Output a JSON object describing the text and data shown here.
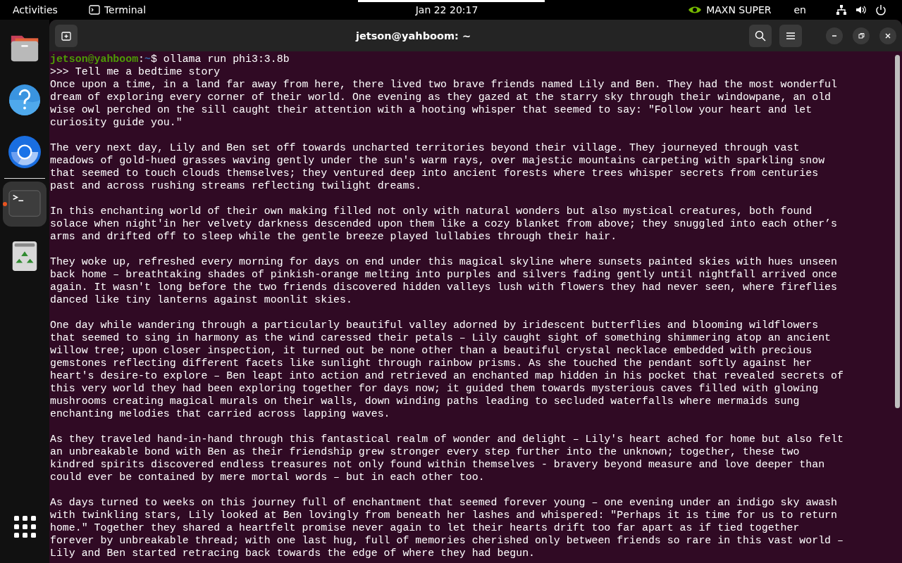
{
  "top_bar": {
    "activities": "Activities",
    "app_name": "Terminal",
    "clock": "Jan 22  20:17",
    "power_mode": "MAXN SUPER",
    "language": "en"
  },
  "dock": {
    "items": [
      {
        "kind": "files",
        "running": false,
        "selected": false
      },
      {
        "kind": "help",
        "running": false,
        "selected": false
      },
      {
        "kind": "browser",
        "running": false,
        "selected": false
      },
      {
        "kind": "terminal",
        "running": true,
        "selected": true
      },
      {
        "kind": "trash",
        "running": false,
        "selected": false
      }
    ]
  },
  "window": {
    "title": "jetson@yahboom: ~"
  },
  "terminal": {
    "prompt": {
      "user": "jetson@yahboom",
      "separator": ":",
      "path": "~",
      "command": "$ ollama run phi3:3.8b"
    },
    "input": ">>> Tell me a bedtime story",
    "paragraphs": [
      [
        "Once upon a time, in a land far away from here, there lived two brave friends named Lily and Ben. They had the most wonderful",
        "dream of exploring every corner of their world. One evening as they gazed at the starry sky through their windowpane, an old",
        "wise owl perched on the sill caught their attention with a hooting whisper that seemed to say: \"Follow your heart and let",
        "curiosity guide you.\""
      ],
      [
        "The very next day, Lily and Ben set off towards uncharted territories beyond their village. They journeyed through vast",
        "meadows of gold-hued grasses waving gently under the sun's warm rays, over majestic mountains carpeting with sparkling snow",
        "that seemed to touch clouds themselves; they ventured deep into ancient forests where trees whisper secrets from centuries",
        "past and across rushing streams reflecting twilight dreams."
      ],
      [
        "In this enchanting world of their own making filled not only with natural wonders but also mystical creatures, both found",
        "solace when night'in her velvety darkness descended upon them like a cozy blanket from above; they snuggled into each other’s",
        "arms and drifted off to sleep while the gentle breeze played lullabies through their hair."
      ],
      [
        "They woke up, refreshed every morning for days on end under this magical skyline where sunsets painted skies with hues unseen",
        "back home – breathtaking shades of pinkish-orange melting into purples and silvers fading gently until nightfall arrived once",
        "again. It wasn't long before the two friends discovered hidden valleys lush with flowers they had never seen, where fireflies",
        "danced like tiny lanterns against moonlit skies."
      ],
      [
        "One day while wandering through a particularly beautiful valley adorned by iridescent butterflies and blooming wildflowers",
        "that seemed to sing in harmony as the wind caressed their petals – Lily caught sight of something shimmering atop an ancient",
        "willow tree; upon closer inspection, it turned out be none other than a beautiful crystal necklace embedded with precious",
        "gemstones reflecting different facets like sunlight through rainbow prisms. As she touched the pendant softly against her",
        "heart's desire-to explore – Ben leapt into action and retrieved an enchanted map hidden in his pocket that revealed secrets of",
        "this very world they had been exploring together for days now; it guided them towards mysterious caves filled with glowing",
        "mushrooms creating magical murals on their walls, down winding paths leading to secluded waterfalls where mermaids sung",
        "enchanting melodies that carried across lapping waves."
      ],
      [
        "As they traveled hand-in-hand through this fantastical realm of wonder and delight – Lily's heart ached for home but also felt",
        "an unbreakable bond with Ben as their friendship grew stronger every step further into the unknown; together, these two",
        "kindred spirits discovered endless treasures not only found within themselves - bravery beyond measure and love deeper than",
        "could ever be contained by mere mortal words – but in each other too."
      ],
      [
        "As days turned to weeks on this journey full of enchantment that seemed forever young – one evening under an indigo sky awash",
        "with twinkling stars, Lily looked at Ben lovingly from beneath her lashes and whispered: \"Perhaps it is time for us to return",
        "home.\" Together they shared a heartfelt promise never again to let their hearts drift too far apart as if tied together",
        "forever by unbreakable thread; with one last hug, full of memories cherished only between friends so rare in this vast world –",
        "Lily and Ben started retracing back towards the edge of where they had begun."
      ]
    ]
  }
}
